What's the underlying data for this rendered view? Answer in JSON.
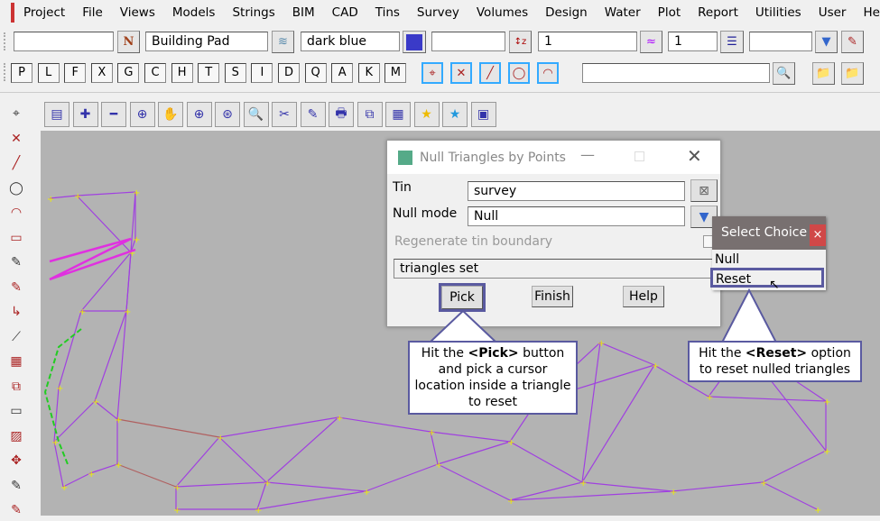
{
  "menu": [
    "Project",
    "File",
    "Views",
    "Models",
    "Strings",
    "BIM",
    "CAD",
    "Tins",
    "Survey",
    "Volumes",
    "Design",
    "Water",
    "Plot",
    "Report",
    "Utilities",
    "User",
    "Help"
  ],
  "toolbar": {
    "name_value": "",
    "model_value": "Building Pad",
    "colour_value": "dark blue",
    "colour_swatch": "#3a3ac8",
    "z_value": "",
    "weight_value": "1",
    "linestyle_value": "1",
    "extra_value": "",
    "search_value": ""
  },
  "letter_buttons": [
    "P",
    "L",
    "F",
    "X",
    "G",
    "C",
    "H",
    "T",
    "S",
    "I",
    "D",
    "Q",
    "A",
    "K",
    "M"
  ],
  "dialog": {
    "title": "Null Triangles by Points",
    "tin_label": "Tin",
    "tin_value": "survey",
    "null_mode_label": "Null mode",
    "null_mode_value": "Null",
    "regenerate_label": "Regenerate tin boundary",
    "status": "triangles set",
    "pick": "Pick",
    "finish": "Finish",
    "help": "Help"
  },
  "popup": {
    "title": "Select Choice",
    "close": "×",
    "options": [
      "Null",
      "Reset"
    ],
    "selected": "Reset"
  },
  "callouts": {
    "pick": {
      "pre": "Hit the ",
      "bold": "<Pick>",
      "post": " button and pick a cursor location inside a triangle to reset"
    },
    "reset": {
      "pre": "Hit the ",
      "bold": "<Reset>",
      "post": " option to reset nulled triangles"
    }
  },
  "colors": {
    "canvas": "#b3b3b3",
    "mesh": "#a040e0",
    "highlight": "#5a5aa0",
    "popup_header": "#787070",
    "close": "#d04848"
  }
}
